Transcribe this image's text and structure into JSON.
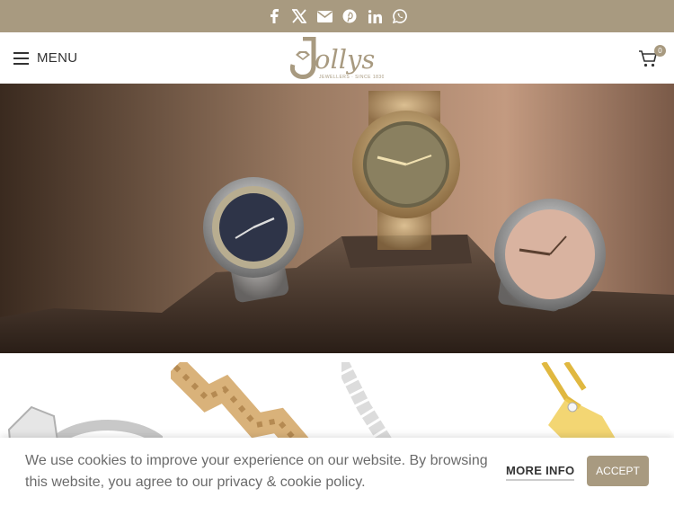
{
  "topbar": {
    "social_icons": [
      "facebook-icon",
      "x-icon",
      "email-icon",
      "pinterest-icon",
      "linkedin-icon",
      "whatsapp-icon"
    ]
  },
  "header": {
    "menu_label": "MENU",
    "logo_text": "Jollys",
    "logo_tagline": "JEWELLERS SINCE 1830",
    "cart_count": "0"
  },
  "cookie": {
    "text": "We use cookies to improve your experience on our website. By browsing this website, you agree to our privacy & cookie policy.",
    "more_info": "MORE INFO",
    "accept": "ACCEPT"
  },
  "colors": {
    "brand": "#a89a80",
    "gold": "#c9a468"
  }
}
